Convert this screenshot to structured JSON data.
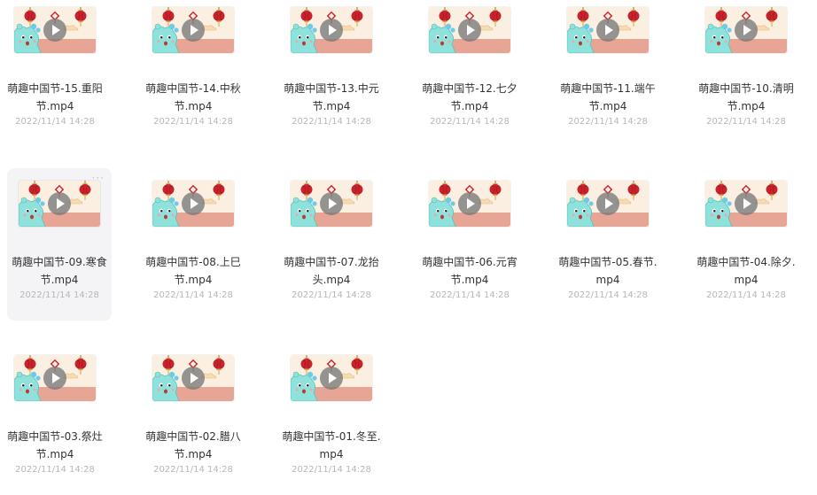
{
  "files": [
    {
      "name": "萌趣中国节-15.重阳节.mp4",
      "date": "2022/11/14 14:28"
    },
    {
      "name": "萌趣中国节-14.中秋节.mp4",
      "date": "2022/11/14 14:28"
    },
    {
      "name": "萌趣中国节-13.中元节.mp4",
      "date": "2022/11/14 14:28"
    },
    {
      "name": "萌趣中国节-12.七夕节.mp4",
      "date": "2022/11/14 14:28"
    },
    {
      "name": "萌趣中国节-11.端午节.mp4",
      "date": "2022/11/14 14:28"
    },
    {
      "name": "萌趣中国节-10.清明节.mp4",
      "date": "2022/11/14 14:28"
    },
    {
      "name": "萌趣中国节-09.寒食节.mp4",
      "date": "2022/11/14 14:28"
    },
    {
      "name": "萌趣中国节-08.上巳节.mp4",
      "date": "2022/11/14 14:28"
    },
    {
      "name": "萌趣中国节-07.龙抬头.mp4",
      "date": "2022/11/14 14:28"
    },
    {
      "name": "萌趣中国节-06.元宵节.mp4",
      "date": "2022/11/14 14:28"
    },
    {
      "name": "萌趣中国节-05.春节.mp4",
      "date": "2022/11/14 14:28"
    },
    {
      "name": "萌趣中国节-04.除夕.mp4",
      "date": "2022/11/14 14:28"
    },
    {
      "name": "萌趣中国节-03.祭灶节.mp4",
      "date": "2022/11/14 14:28"
    },
    {
      "name": "萌趣中国节-02.腊八节.mp4",
      "date": "2022/11/14 14:28"
    },
    {
      "name": "萌趣中国节-01.冬至.mp4",
      "date": "2022/11/14 14:28"
    }
  ],
  "hovered_index": 6,
  "more_icon": "more-dots-icon",
  "play_icon": "play-icon",
  "colors": {
    "thumb_bg": "#fbefe2",
    "thumb_floor": "#e7a595",
    "lantern": "#c8232c",
    "dragon": "#8fe1dc",
    "date_text": "#b7b7b7",
    "hover_bg": "#f4f4f6"
  }
}
